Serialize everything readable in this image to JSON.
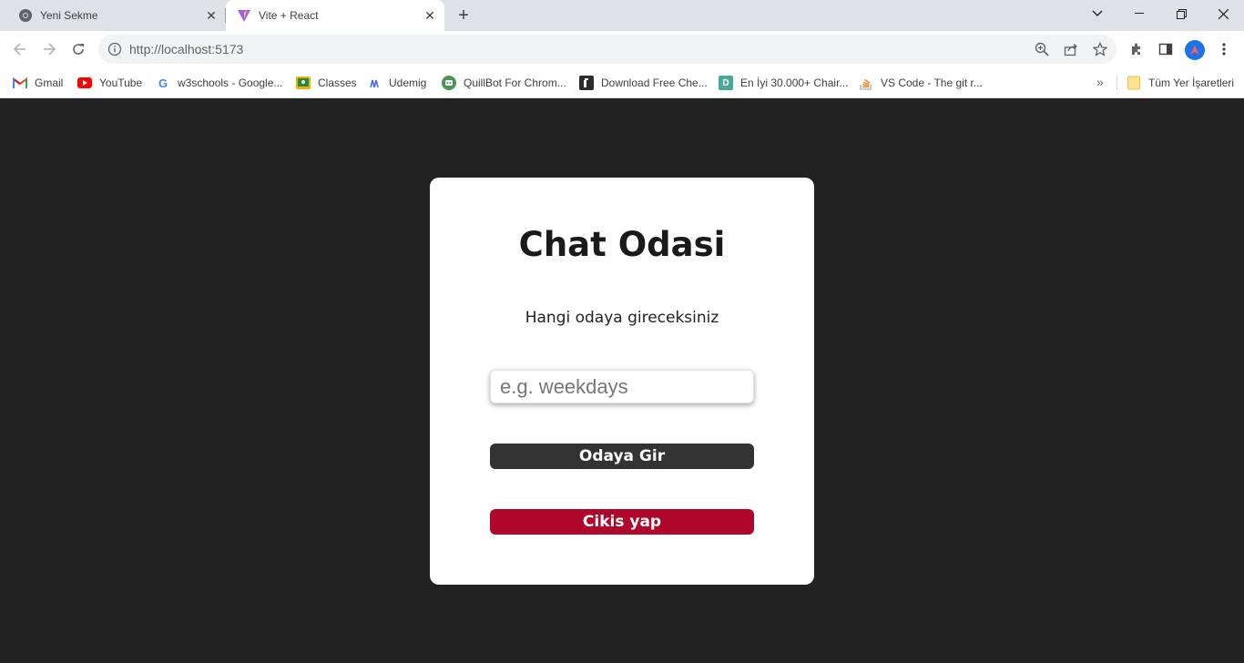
{
  "browser": {
    "tabs": [
      {
        "title": "Yeni Sekme",
        "active": false
      },
      {
        "title": "Vite + React",
        "active": true
      }
    ],
    "url": "http://localhost:5173",
    "bookmarks": [
      {
        "label": "Gmail",
        "icon": "gmail-icon"
      },
      {
        "label": "YouTube",
        "icon": "youtube-icon"
      },
      {
        "label": "w3schools - Google...",
        "icon": "google-icon"
      },
      {
        "label": "Classes",
        "icon": "classroom-icon"
      },
      {
        "label": "Udemig",
        "icon": "udemig-icon"
      },
      {
        "label": "QuillBot For Chrom...",
        "icon": "quillbot-icon"
      },
      {
        "label": "Download Free Che...",
        "icon": "chess-icon"
      },
      {
        "label": "En İyi 30.000+ Chair...",
        "icon": "dribbble-icon"
      },
      {
        "label": "VS Code - The git r...",
        "icon": "stackoverflow-icon"
      }
    ],
    "other_bookmarks_label": "Tüm Yer İşaretleri",
    "more_bookmarks": "»"
  },
  "page": {
    "title": "Chat Odasi",
    "subtitle": "Hangi odaya gireceksiniz",
    "input_placeholder": "e.g. weekdays",
    "enter_button": "Odaya Gir",
    "exit_button": "Cikis yap"
  },
  "colors": {
    "page_bg": "#222222",
    "card_bg": "#ffffff",
    "enter_button_bg": "#333333",
    "exit_button_bg": "#b0082a"
  }
}
